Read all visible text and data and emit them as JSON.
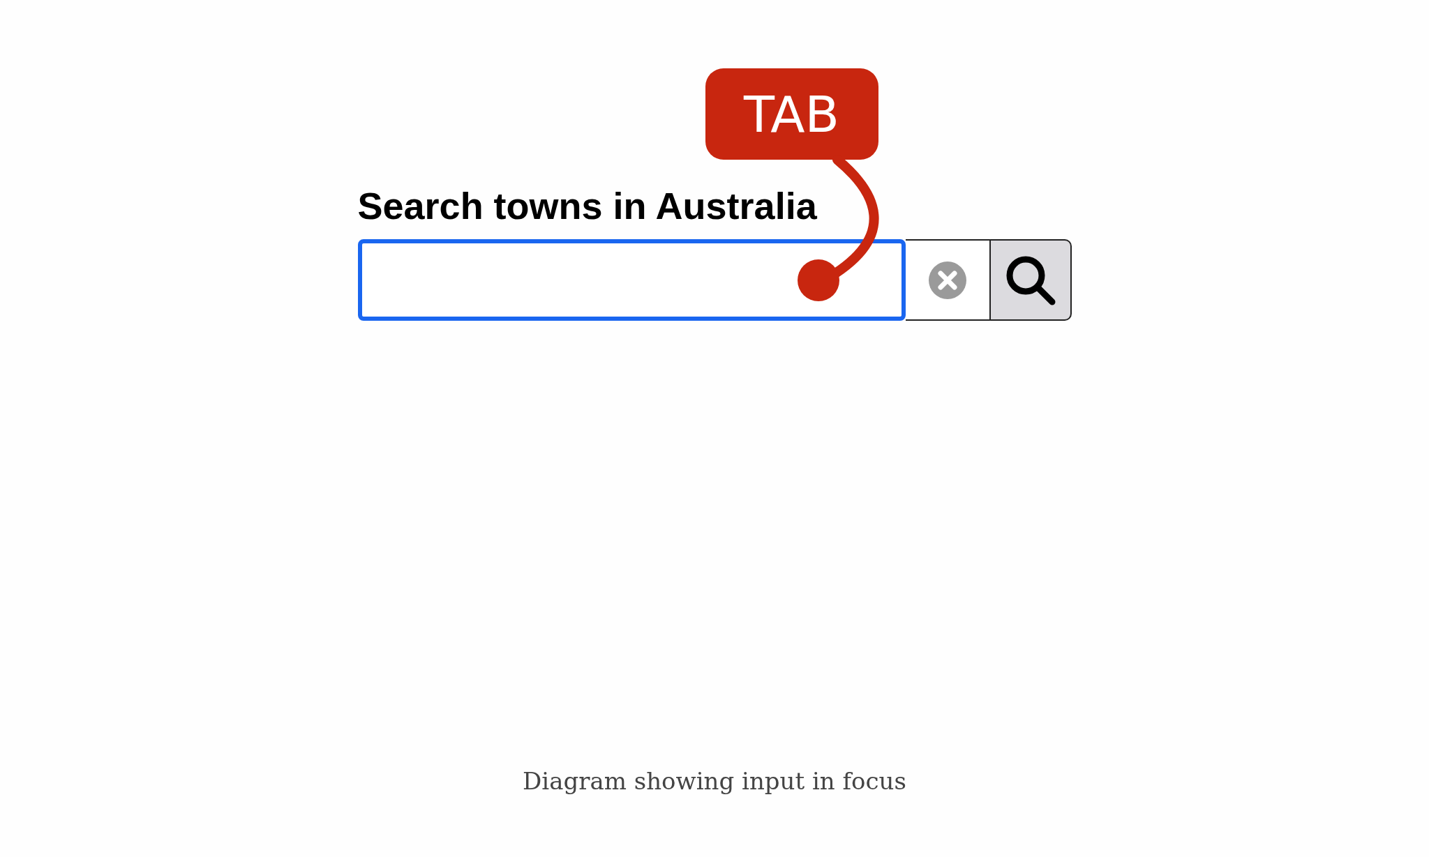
{
  "callout": {
    "label": "TAB"
  },
  "search": {
    "label": "Search towns in Australia",
    "focused": true
  },
  "caption": "Diagram showing input in focus"
}
